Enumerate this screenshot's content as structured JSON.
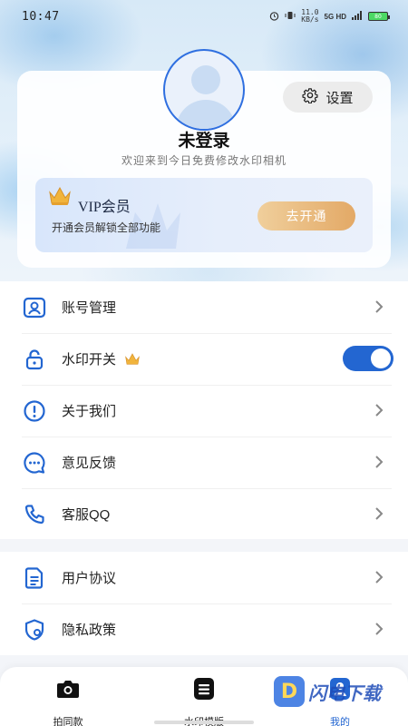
{
  "status_bar": {
    "time": "10:47",
    "net_speed_top": "11.0",
    "net_speed_bottom": "KB/s",
    "signal": "5G HD",
    "battery": "80"
  },
  "profile": {
    "settings_label": "设置",
    "login_status": "未登录",
    "welcome": "欢迎来到今日免费修改水印相机"
  },
  "vip": {
    "title": "VIP会员",
    "subtitle": "开通会员解锁全部功能",
    "button": "去开通"
  },
  "menu_group_1": [
    {
      "label": "账号管理",
      "icon": "account-icon"
    },
    {
      "label": "水印开关",
      "icon": "lock-icon",
      "toggle": true
    },
    {
      "label": "关于我们",
      "icon": "info-icon"
    },
    {
      "label": "意见反馈",
      "icon": "chat-icon"
    },
    {
      "label": "客服QQ",
      "icon": "phone-icon"
    }
  ],
  "menu_group_2": [
    {
      "label": "用户协议",
      "icon": "document-icon"
    },
    {
      "label": "隐私政策",
      "icon": "shield-icon"
    }
  ],
  "bottom_nav": [
    {
      "label": "拍同款",
      "icon": "camera-icon"
    },
    {
      "label": "水印模版",
      "icon": "template-icon"
    },
    {
      "label": "我的",
      "icon": "profile-icon",
      "active": true
    }
  ],
  "watermark": {
    "text": "闪电下载",
    "logo": "D"
  },
  "colors": {
    "accent": "#2366d1",
    "vip_button": "#e8b476",
    "toggle_on": "#2366d1"
  }
}
